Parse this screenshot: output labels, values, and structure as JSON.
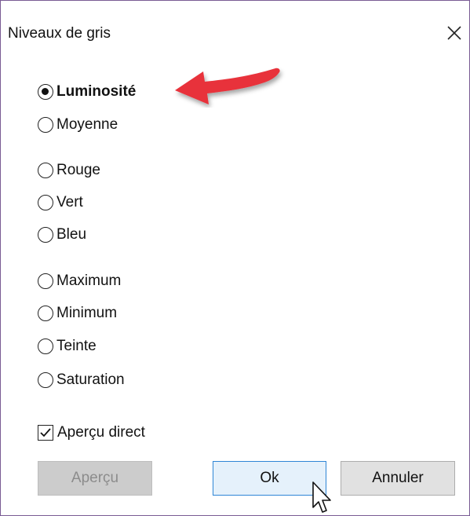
{
  "window": {
    "title": "Niveaux de gris",
    "close_icon": "close-icon"
  },
  "options": [
    {
      "label": "Luminosité",
      "selected": true
    },
    {
      "label": "Moyenne",
      "selected": false
    },
    {
      "label": "Rouge",
      "selected": false
    },
    {
      "label": "Vert",
      "selected": false
    },
    {
      "label": "Bleu",
      "selected": false
    },
    {
      "label": "Maximum",
      "selected": false
    },
    {
      "label": "Minimum",
      "selected": false
    },
    {
      "label": "Teinte",
      "selected": false
    },
    {
      "label": "Saturation",
      "selected": false
    }
  ],
  "live_preview": {
    "label": "Aperçu direct",
    "checked": true
  },
  "buttons": {
    "preview": "Aperçu",
    "ok": "Ok",
    "cancel": "Annuler"
  },
  "annotation": {
    "arrow_color": "#e8323a",
    "arrow_icon": "red-arrow-icon"
  },
  "colors": {
    "ok_border": "#2f86d6",
    "ok_fill": "#e5f1fb",
    "window_border": "#7a5b94"
  }
}
